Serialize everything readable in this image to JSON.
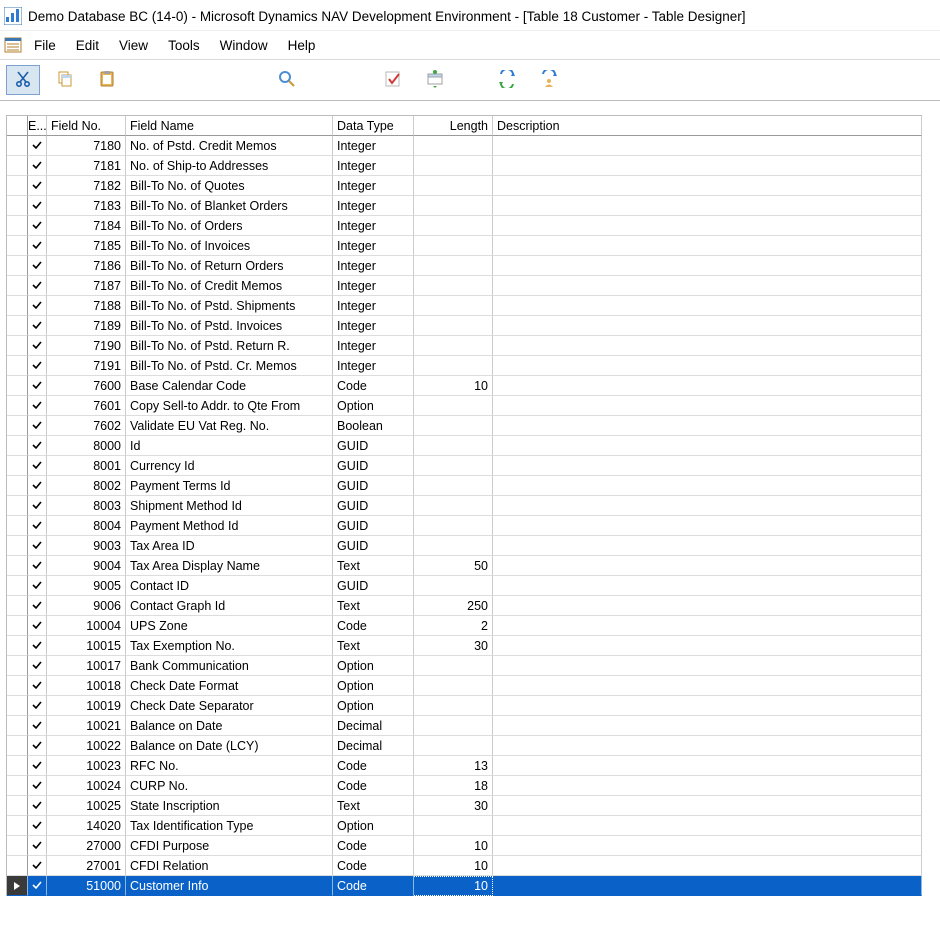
{
  "title": "Demo Database BC (14-0) - Microsoft Dynamics NAV Development Environment - [Table 18 Customer - Table Designer]",
  "menu": {
    "file": "File",
    "edit": "Edit",
    "view": "View",
    "tools": "Tools",
    "window": "Window",
    "help": "Help"
  },
  "columns": {
    "enabled": "E...",
    "field_no": "Field No.",
    "field_name": "Field Name",
    "data_type": "Data Type",
    "length": "Length",
    "description": "Description"
  },
  "rows": [
    {
      "enabled": true,
      "no": 7180,
      "name": "No. of Pstd. Credit Memos",
      "type": "Integer",
      "len": "",
      "desc": "",
      "selected": false
    },
    {
      "enabled": true,
      "no": 7181,
      "name": "No. of Ship-to Addresses",
      "type": "Integer",
      "len": "",
      "desc": "",
      "selected": false
    },
    {
      "enabled": true,
      "no": 7182,
      "name": "Bill-To No. of Quotes",
      "type": "Integer",
      "len": "",
      "desc": "",
      "selected": false
    },
    {
      "enabled": true,
      "no": 7183,
      "name": "Bill-To No. of Blanket Orders",
      "type": "Integer",
      "len": "",
      "desc": "",
      "selected": false
    },
    {
      "enabled": true,
      "no": 7184,
      "name": "Bill-To No. of Orders",
      "type": "Integer",
      "len": "",
      "desc": "",
      "selected": false
    },
    {
      "enabled": true,
      "no": 7185,
      "name": "Bill-To No. of Invoices",
      "type": "Integer",
      "len": "",
      "desc": "",
      "selected": false
    },
    {
      "enabled": true,
      "no": 7186,
      "name": "Bill-To No. of Return Orders",
      "type": "Integer",
      "len": "",
      "desc": "",
      "selected": false
    },
    {
      "enabled": true,
      "no": 7187,
      "name": "Bill-To No. of Credit Memos",
      "type": "Integer",
      "len": "",
      "desc": "",
      "selected": false
    },
    {
      "enabled": true,
      "no": 7188,
      "name": "Bill-To No. of Pstd. Shipments",
      "type": "Integer",
      "len": "",
      "desc": "",
      "selected": false
    },
    {
      "enabled": true,
      "no": 7189,
      "name": "Bill-To No. of Pstd. Invoices",
      "type": "Integer",
      "len": "",
      "desc": "",
      "selected": false
    },
    {
      "enabled": true,
      "no": 7190,
      "name": "Bill-To No. of Pstd. Return R.",
      "type": "Integer",
      "len": "",
      "desc": "",
      "selected": false
    },
    {
      "enabled": true,
      "no": 7191,
      "name": "Bill-To No. of Pstd. Cr. Memos",
      "type": "Integer",
      "len": "",
      "desc": "",
      "selected": false
    },
    {
      "enabled": true,
      "no": 7600,
      "name": "Base Calendar Code",
      "type": "Code",
      "len": 10,
      "desc": "",
      "selected": false
    },
    {
      "enabled": true,
      "no": 7601,
      "name": "Copy Sell-to Addr. to Qte From",
      "type": "Option",
      "len": "",
      "desc": "",
      "selected": false
    },
    {
      "enabled": true,
      "no": 7602,
      "name": "Validate EU Vat Reg. No.",
      "type": "Boolean",
      "len": "",
      "desc": "",
      "selected": false
    },
    {
      "enabled": true,
      "no": 8000,
      "name": "Id",
      "type": "GUID",
      "len": "",
      "desc": "",
      "selected": false
    },
    {
      "enabled": true,
      "no": 8001,
      "name": "Currency Id",
      "type": "GUID",
      "len": "",
      "desc": "",
      "selected": false
    },
    {
      "enabled": true,
      "no": 8002,
      "name": "Payment Terms Id",
      "type": "GUID",
      "len": "",
      "desc": "",
      "selected": false
    },
    {
      "enabled": true,
      "no": 8003,
      "name": "Shipment Method Id",
      "type": "GUID",
      "len": "",
      "desc": "",
      "selected": false
    },
    {
      "enabled": true,
      "no": 8004,
      "name": "Payment Method Id",
      "type": "GUID",
      "len": "",
      "desc": "",
      "selected": false
    },
    {
      "enabled": true,
      "no": 9003,
      "name": "Tax Area ID",
      "type": "GUID",
      "len": "",
      "desc": "",
      "selected": false
    },
    {
      "enabled": true,
      "no": 9004,
      "name": "Tax Area Display Name",
      "type": "Text",
      "len": 50,
      "desc": "",
      "selected": false
    },
    {
      "enabled": true,
      "no": 9005,
      "name": "Contact ID",
      "type": "GUID",
      "len": "",
      "desc": "",
      "selected": false
    },
    {
      "enabled": true,
      "no": 9006,
      "name": "Contact Graph Id",
      "type": "Text",
      "len": 250,
      "desc": "",
      "selected": false
    },
    {
      "enabled": true,
      "no": 10004,
      "name": "UPS Zone",
      "type": "Code",
      "len": 2,
      "desc": "",
      "selected": false
    },
    {
      "enabled": true,
      "no": 10015,
      "name": "Tax Exemption No.",
      "type": "Text",
      "len": 30,
      "desc": "",
      "selected": false
    },
    {
      "enabled": true,
      "no": 10017,
      "name": "Bank Communication",
      "type": "Option",
      "len": "",
      "desc": "",
      "selected": false
    },
    {
      "enabled": true,
      "no": 10018,
      "name": "Check Date Format",
      "type": "Option",
      "len": "",
      "desc": "",
      "selected": false
    },
    {
      "enabled": true,
      "no": 10019,
      "name": "Check Date Separator",
      "type": "Option",
      "len": "",
      "desc": "",
      "selected": false
    },
    {
      "enabled": true,
      "no": 10021,
      "name": "Balance on Date",
      "type": "Decimal",
      "len": "",
      "desc": "",
      "selected": false
    },
    {
      "enabled": true,
      "no": 10022,
      "name": "Balance on Date (LCY)",
      "type": "Decimal",
      "len": "",
      "desc": "",
      "selected": false
    },
    {
      "enabled": true,
      "no": 10023,
      "name": "RFC No.",
      "type": "Code",
      "len": 13,
      "desc": "",
      "selected": false
    },
    {
      "enabled": true,
      "no": 10024,
      "name": "CURP No.",
      "type": "Code",
      "len": 18,
      "desc": "",
      "selected": false
    },
    {
      "enabled": true,
      "no": 10025,
      "name": "State Inscription",
      "type": "Text",
      "len": 30,
      "desc": "",
      "selected": false
    },
    {
      "enabled": true,
      "no": 14020,
      "name": "Tax Identification Type",
      "type": "Option",
      "len": "",
      "desc": "",
      "selected": false
    },
    {
      "enabled": true,
      "no": 27000,
      "name": "CFDI Purpose",
      "type": "Code",
      "len": 10,
      "desc": "",
      "selected": false
    },
    {
      "enabled": true,
      "no": 27001,
      "name": "CFDI Relation",
      "type": "Code",
      "len": 10,
      "desc": "",
      "selected": false
    },
    {
      "enabled": true,
      "no": 51000,
      "name": "Customer Info",
      "type": "Code",
      "len": 10,
      "desc": "",
      "selected": true
    }
  ]
}
